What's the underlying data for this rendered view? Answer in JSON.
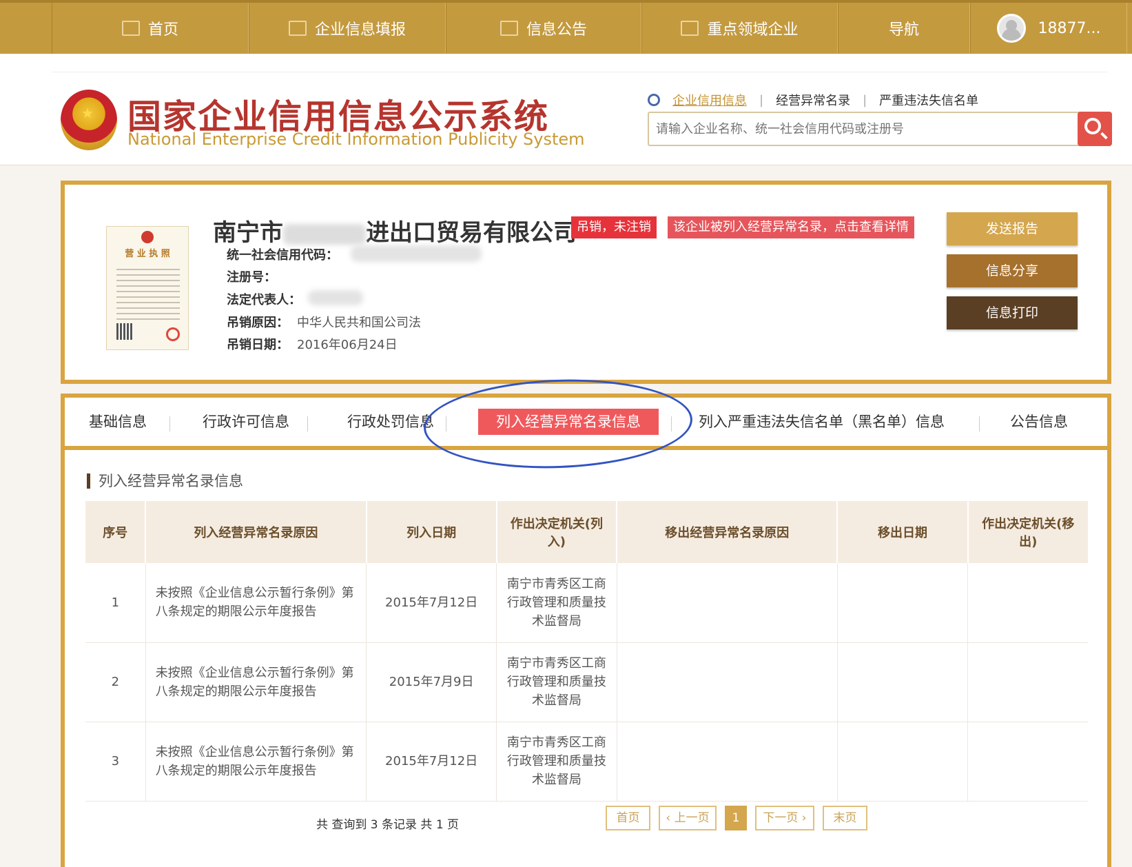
{
  "nav": {
    "items": [
      {
        "label": "首页",
        "icon": "monitor-icon"
      },
      {
        "label": "企业信息填报",
        "icon": "edit-icon"
      },
      {
        "label": "信息公告",
        "icon": "document-icon"
      },
      {
        "label": "重点领域企业",
        "icon": "speaker-icon"
      },
      {
        "label": "导航"
      }
    ],
    "user": "18877..."
  },
  "header": {
    "logo_cn": "国家企业信用信息公示系统",
    "logo_en": "National Enterprise Credit Information Publicity System",
    "search_links": [
      "企业信用信息",
      "经营异常名录",
      "严重违法失信名单"
    ],
    "search_placeholder": "请输入企业名称、统一社会信用代码或注册号"
  },
  "company": {
    "license_title": "营 业 执 照",
    "name_prefix": "南宁市",
    "name_suffix": "进出口贸易有限公司",
    "status_badge": "吊销，未注销",
    "abnormal_badge": "该企业被列入经营异常名录，点击查看详情",
    "fields": {
      "credit_code_label": "统一社会信用代码：",
      "reg_no_label": "注册号：",
      "legal_rep_label": "法定代表人：",
      "revoke_reason_label": "吊销原因：",
      "revoke_reason": "中华人民共和国公司法",
      "revoke_date_label": "吊销日期：",
      "revoke_date": "2016年06月24日"
    },
    "buttons": {
      "send": "发送报告",
      "share": "信息分享",
      "print": "信息打印"
    }
  },
  "tabs": [
    "基础信息",
    "行政许可信息",
    "行政处罚信息",
    "列入经营异常名录信息",
    "列入严重违法失信名单（黑名单）信息",
    "公告信息"
  ],
  "section_title": "列入经营异常名录信息",
  "table": {
    "headers": [
      "序号",
      "列入经营异常名录原因",
      "列入日期",
      "作出决定机关(列入)",
      "移出经营异常名录原因",
      "移出日期",
      "作出决定机关(移出)"
    ],
    "rows": [
      {
        "no": "1",
        "reason": "未按照《企业信息公示暂行条例》第八条规定的期限公示年度报告",
        "date": "2015年7月12日",
        "authority": "南宁市青秀区工商行政管理和质量技术监督局"
      },
      {
        "no": "2",
        "reason": "未按照《企业信息公示暂行条例》第八条规定的期限公示年度报告",
        "date": "2015年7月9日",
        "authority": "南宁市青秀区工商行政管理和质量技术监督局"
      },
      {
        "no": "3",
        "reason": "未按照《企业信息公示暂行条例》第八条规定的期限公示年度报告",
        "date": "2015年7月12日",
        "authority": "南宁市青秀区工商行政管理和质量技术监督局"
      }
    ]
  },
  "pager": {
    "info": "共 查询到 3 条记录 共 1 页",
    "first": "首页",
    "prev": "‹ 上一页",
    "current": "1",
    "next": "下一页 ›",
    "last": "末页"
  }
}
